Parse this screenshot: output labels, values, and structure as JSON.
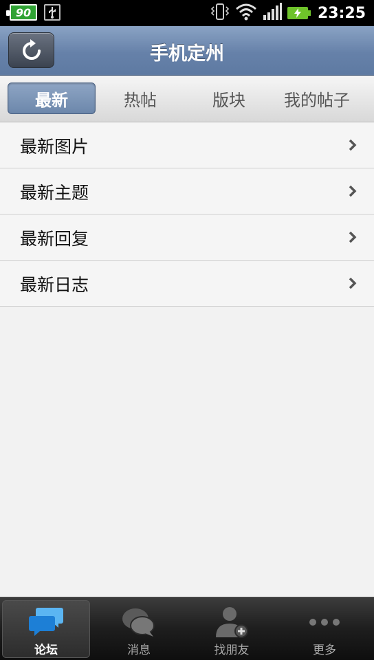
{
  "status_bar": {
    "notification_badge": "90",
    "time": "23:25"
  },
  "header": {
    "title": "手机定州"
  },
  "tabs": [
    {
      "label": "最新",
      "active": true
    },
    {
      "label": "热帖",
      "active": false
    },
    {
      "label": "版块",
      "active": false
    },
    {
      "label": "我的帖子",
      "active": false
    }
  ],
  "list": {
    "items": [
      {
        "label": "最新图片"
      },
      {
        "label": "最新主题"
      },
      {
        "label": "最新回复"
      },
      {
        "label": "最新日志"
      }
    ]
  },
  "bottom_nav": [
    {
      "label": "论坛",
      "icon": "forum-icon",
      "active": true
    },
    {
      "label": "消息",
      "icon": "message-icon",
      "active": false
    },
    {
      "label": "找朋友",
      "icon": "find-friend-icon",
      "active": false
    },
    {
      "label": "更多",
      "icon": "more-icon",
      "active": false
    }
  ],
  "colors": {
    "header": "#6f89ae",
    "tab_active": "#7d96b8",
    "background": "#f2f2f2",
    "bottom_bar": "#1e1e1e",
    "forum_icon": "#2a8ee0"
  }
}
